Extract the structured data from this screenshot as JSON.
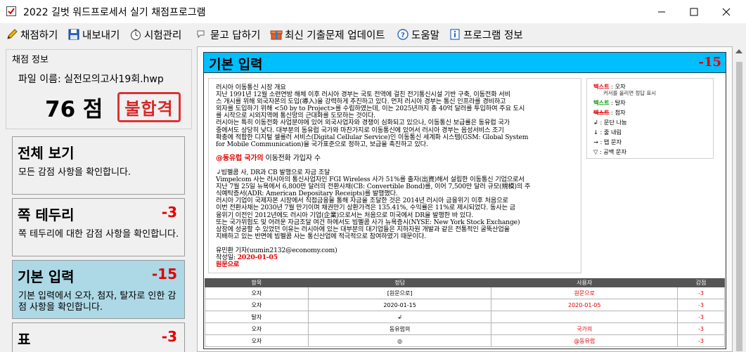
{
  "window": {
    "title": "2022 길벗 워드프로세서 실기 채점프로그램"
  },
  "menu": [
    {
      "label": "채점하기",
      "icon": "pencil-icon"
    },
    {
      "label": "내보내기",
      "icon": "save-icon"
    },
    {
      "label": "시험관리",
      "icon": "timer-icon"
    },
    {
      "label": "묻고 답하기",
      "icon": "chat-icon"
    },
    {
      "label": "최신 기출문제 업데이트",
      "icon": "gift-icon"
    },
    {
      "label": "도움말",
      "icon": "help-icon"
    },
    {
      "label": "프로그램 정보",
      "icon": "info-icon"
    }
  ],
  "score_info": {
    "legend": "채점 정보",
    "file_name": "파일 이름: 실전모의고사19회.hwp",
    "score": "76 점",
    "result_stamp": "불합격"
  },
  "cards": [
    {
      "title": "전체 보기",
      "deduction": "",
      "desc": "모든 감점 사항을 확인합니다."
    },
    {
      "title": "쪽 테두리",
      "deduction": "-3",
      "desc": "쪽 테두리에 대한 감점 사항을 확인합니다."
    },
    {
      "title": "기본 입력",
      "deduction": "-15",
      "desc": "기본 입력에서 오자, 첨자, 탈자로 인한 감점 사항을 확인합니다."
    },
    {
      "title": "표",
      "deduction": "-3",
      "desc": ""
    }
  ],
  "section": {
    "title": "기본 입력",
    "deduction": "-15"
  },
  "document": {
    "p1": [
      "러시아 이동통신 시장 개요",
      "지난 1991년 12월 소련연방 해체 이후 러시아 경부는 국토 전역에 걸친 전기통신시설 기반 구축, 이동전화 서비",
      "스 개시를 위해 외국자본의 도입(導入)을 강력하게 추진하고 있다. 먼저 러시아 경부는 통신 인프라를 경비하고",
      "외자를 도입하기 위해 <50 by to Project>를 수립하였는데, 이는 2025년까지 총 40억 달러를 투입하여 주요 도시",
      "를 시작으로 시외지역에 통신망의 근대화를 도모하는 것이다.",
      "러시아는 특히 이동전화 사업분야에 있어 외국사업자와 경쟁이 심화되고 있으나, 이동통신 보급률은 동유럽 국가",
      "중에서도 상당히 낮다. 대부분의 동유럽 국가와 마찬가지로 이동통신에 있어서 러시아 경부는 음성서비스 조기",
      "확충에 적합한 디지털 셀룰러 서비스(Digital Cellular Service)인 이동통신 세계화 시스템(GSM: Global System",
      "for Mobile Communication)을 국가표준으로 정하고, 보급을 촉진하고 있다."
    ],
    "heading_red": "@동유럽 국가의",
    "heading_rest": " 이동전화 가입자 수",
    "p2": [
      "↲빔펠콤 사, DR과 CB 발행으로 자금 조달",
      "Vimpelcom 사는 러시아의 통신사업자인 FGI Wireless 사가 51%를 출자(出資)해서 설립한 이동통신 기업으로서",
      "지난 7월 25일 뉴욕에서 6,800만 달러의 전환사채(CB: Convertible Bond)를, 이어 7,500만 달러 규모(規模)의 주",
      "식예탁증서(ADR: American Depositary Receipts)를 발행했다.",
      "러시아 기업이 국제자본 시장에서 직접금융을 통해 자금을 조달한 것은 2014년 러시아 금융위기 이후 처음으로",
      "이번 전환사채는 2030년 7월 만기이며 채권만기 상환가격은 135.41%, 수익률은 11%로 제시되었다. 동사는 금",
      "융위기 이전인 2012년에도 러시아 기업(企業)으로서는 처음으로 미국에서 DR을 발행한 바 있다.",
      "또는 국가위험도 및 어려운 자금조달 여건 하에서도 빔펠콤 사가 뉴욕증시(NYSE: New York Stock Exchange)",
      "상장에 성공할 수 있었던 이유는 러시아에 있는 대부분의 대기업들은 지하자원 개발과 같은 전통적인 굴뚝산업을",
      "지배하고 있는 반면에 빔펠콤 사는 통신산업에 적극적으로 참여하였기 때문이다."
    ],
    "reporter": "유민환 기자(uumin2132@economy.com)",
    "date_prefix": "작성일: ",
    "date_red": "2020-01-05",
    "source_red": "원문으로"
  },
  "legend": {
    "typo_label": "텍스트",
    "typo_name": " : 오자",
    "typo_sub": "커서를 올리면 정답 표시",
    "missing_label": "텍스트",
    "missing_name": " : 탈자",
    "extra_label": "텍스트",
    "extra_name": " : 첨자",
    "para_mark": "↲ : 문단 나눔",
    "line_mark": "↓ : 줄 내림",
    "tab_mark": "→ : 탭 문자",
    "space_mark": "▽ : 공백 문자"
  },
  "table": {
    "headers": [
      "항목",
      "정답",
      "사용자",
      "감점"
    ],
    "rows": [
      {
        "item": "오자",
        "answer": "[원문으로]",
        "user": "원문으로",
        "deduct": "-3"
      },
      {
        "item": "오자",
        "answer": "2020-01-15",
        "user": "2020-01-05",
        "deduct": "-3"
      },
      {
        "item": "탈자",
        "answer": "↲",
        "user": "",
        "deduct": "-3"
      },
      {
        "item": "오자",
        "answer": "동유럽의",
        "user": "국가의",
        "deduct": "-3"
      },
      {
        "item": "오자",
        "answer": "◎",
        "user": "@동유럽",
        "deduct": "-3"
      }
    ]
  },
  "colors": {
    "accent_blue": "#00bfff",
    "active_card": "#add8e6",
    "deduction_red": "#e00000"
  }
}
